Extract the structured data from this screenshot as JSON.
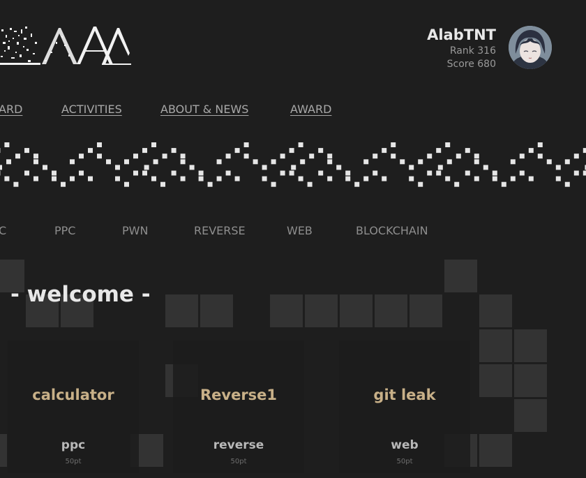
{
  "user": {
    "name": "AlabTNT",
    "rank": "Rank 316",
    "score": "Score 680"
  },
  "nav": [
    {
      "label": "ARD"
    },
    {
      "label": "ACTIVITIES"
    },
    {
      "label": "ABOUT & NEWS"
    },
    {
      "label": "AWARD"
    }
  ],
  "categories": [
    {
      "label": "C"
    },
    {
      "label": "PPC"
    },
    {
      "label": "PWN"
    },
    {
      "label": "REVERSE"
    },
    {
      "label": "WEB"
    },
    {
      "label": "BLOCKCHAIN"
    }
  ],
  "welcome": "- welcome -",
  "challenges": [
    {
      "title": "calculator",
      "category": "ppc",
      "points": "50pt"
    },
    {
      "title": "Reverse1",
      "category": "reverse",
      "points": "50pt"
    },
    {
      "title": "git leak",
      "category": "web",
      "points": "50pt"
    }
  ],
  "colors": {
    "background": "#1e1e1e",
    "tile": "#333333",
    "challenge_title": "#c8b088"
  }
}
